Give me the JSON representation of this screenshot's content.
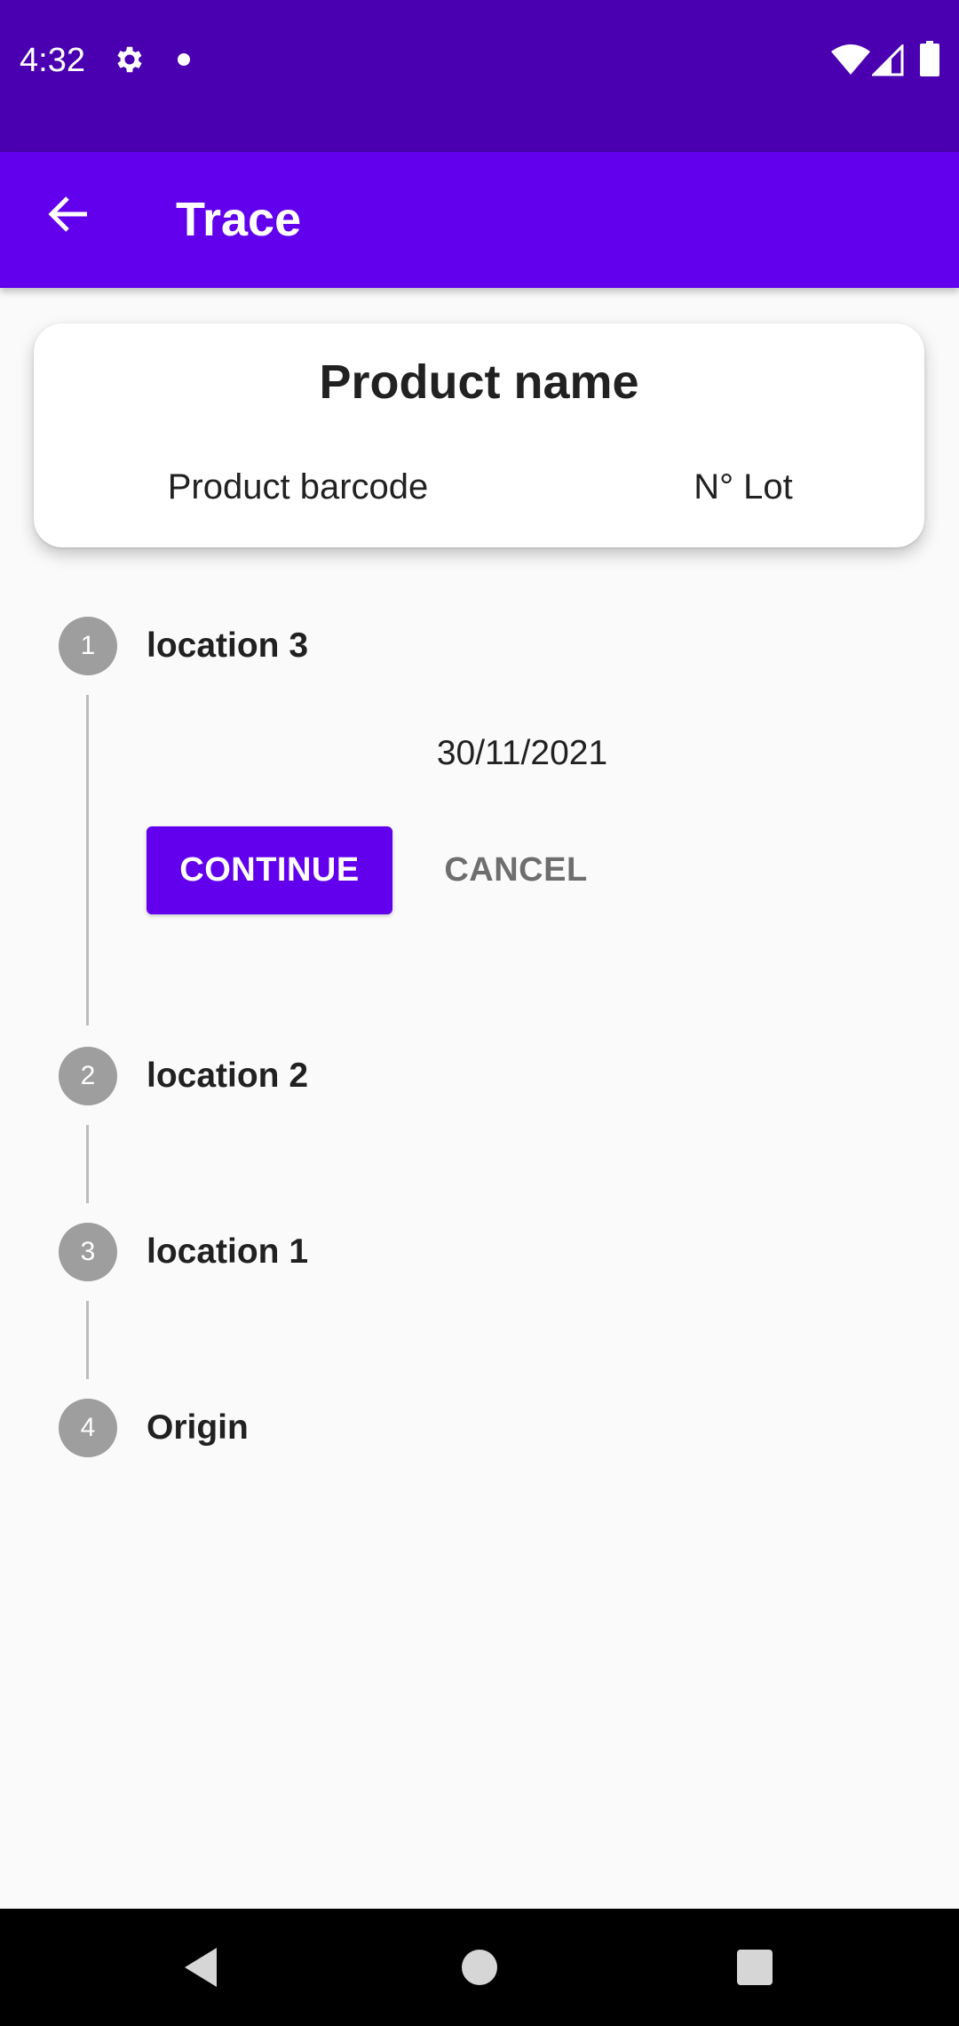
{
  "status_bar": {
    "time": "4:32",
    "icons": [
      "gear-icon",
      "notification-dot-icon",
      "wifi-icon",
      "cell-signal-icon",
      "battery-icon"
    ]
  },
  "app_bar": {
    "title": "Trace",
    "back_icon": "arrow-back-icon",
    "color": "#6200EE"
  },
  "product_card": {
    "name": "Product name",
    "barcode": "Product barcode",
    "lot": "N° Lot"
  },
  "stepper": {
    "steps": [
      {
        "number": "1",
        "label": "location 3",
        "date": "30/11/2021",
        "active": true
      },
      {
        "number": "2",
        "label": "location 2"
      },
      {
        "number": "3",
        "label": "location 1"
      },
      {
        "number": "4",
        "label": "Origin"
      }
    ],
    "continue_label": "CONTINUE",
    "cancel_label": "CANCEL"
  },
  "nav_bar": {
    "icons": [
      "nav-back-icon",
      "nav-home-icon",
      "nav-recents-icon"
    ]
  },
  "colors": {
    "status_bar": "#4A00B0",
    "accent": "#6200EE",
    "step_circle": "#9E9E9E",
    "background": "#FAFAFA"
  }
}
